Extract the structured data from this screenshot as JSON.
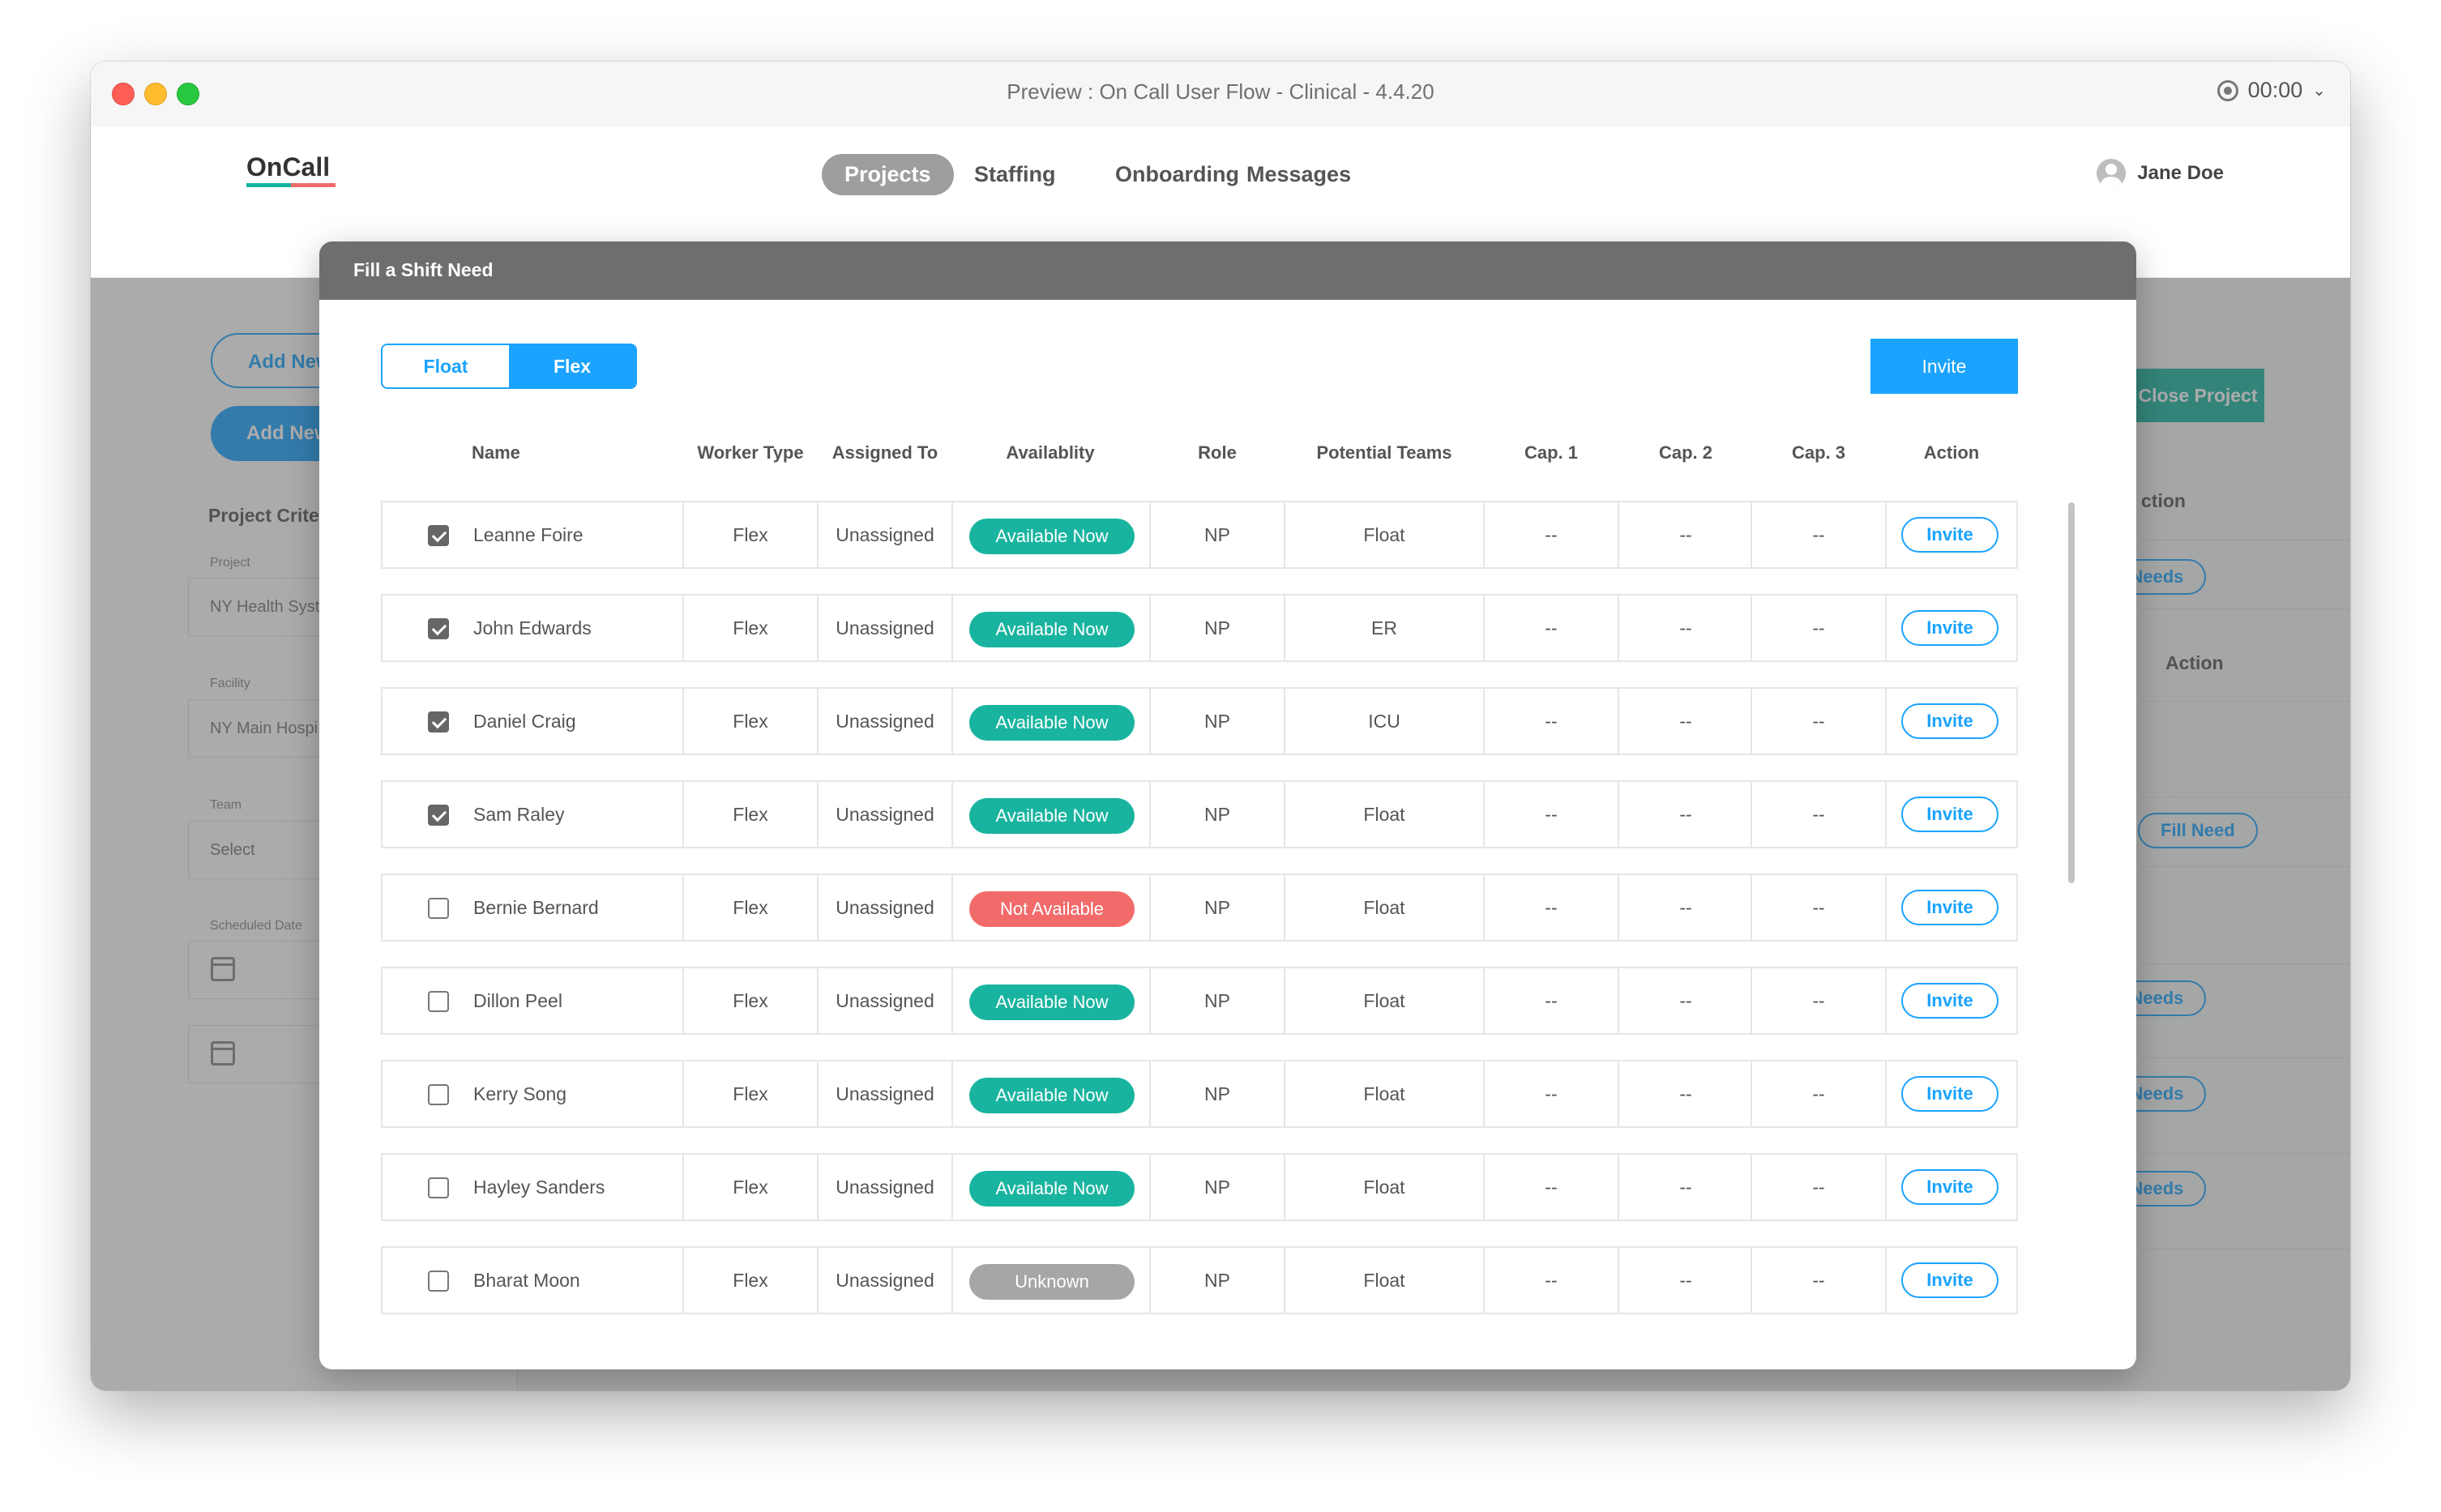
{
  "window": {
    "title": "Preview : On Call User Flow - Clinical - 4.4.20",
    "timer": "00:00"
  },
  "app": {
    "logo": "OnCall",
    "nav": [
      {
        "label": "Projects",
        "active": true
      },
      {
        "label": "Staffing",
        "active": false
      },
      {
        "label": "Onboarding",
        "active": false
      },
      {
        "label": "Messages",
        "active": false
      }
    ],
    "user": "Jane Doe"
  },
  "background": {
    "add_new_outline": "Add New",
    "add_new_filled": "Add New",
    "criteria_title": "Project Criter",
    "fields": [
      {
        "label": "Project",
        "value": "NY Health Syst"
      },
      {
        "label": "Facility",
        "value": "NY Main Hospi"
      },
      {
        "label": "Team",
        "value": "Select"
      }
    ],
    "scheduled_date_label": "Scheduled Date",
    "close_project": "Close Project",
    "action_top": "ction",
    "needs_top": "v Needs",
    "action_header": "Action",
    "fill_need": "Fill Need",
    "needs_rows": [
      "v Needs",
      "v Needs",
      "v Needs"
    ]
  },
  "modal": {
    "title": "Fill a Shift Need",
    "toggle": {
      "float": "Float",
      "flex": "Flex",
      "selected": "Flex"
    },
    "invite_button": "Invite",
    "columns": [
      "Name",
      "Worker Type",
      "Assigned To",
      "Availablity",
      "Role",
      "Potential Teams",
      "Cap. 1",
      "Cap. 2",
      "Cap. 3",
      "Action"
    ],
    "rows": [
      {
        "checked": true,
        "name": "Leanne Foire",
        "worker_type": "Flex",
        "assigned_to": "Unassigned",
        "availability": "Available Now",
        "role": "NP",
        "team": "Float",
        "cap1": "--",
        "cap2": "--",
        "cap3": "--",
        "action": "Invite"
      },
      {
        "checked": true,
        "name": "John Edwards",
        "worker_type": "Flex",
        "assigned_to": "Unassigned",
        "availability": "Available Now",
        "role": "NP",
        "team": "ER",
        "cap1": "--",
        "cap2": "--",
        "cap3": "--",
        "action": "Invite"
      },
      {
        "checked": true,
        "name": "Daniel Craig",
        "worker_type": "Flex",
        "assigned_to": "Unassigned",
        "availability": "Available Now",
        "role": "NP",
        "team": "ICU",
        "cap1": "--",
        "cap2": "--",
        "cap3": "--",
        "action": "Invite"
      },
      {
        "checked": true,
        "name": "Sam Raley",
        "worker_type": "Flex",
        "assigned_to": "Unassigned",
        "availability": "Available Now",
        "role": "NP",
        "team": "Float",
        "cap1": "--",
        "cap2": "--",
        "cap3": "--",
        "action": "Invite"
      },
      {
        "checked": false,
        "name": "Bernie Bernard",
        "worker_type": "Flex",
        "assigned_to": "Unassigned",
        "availability": "Not Available",
        "role": "NP",
        "team": "Float",
        "cap1": "--",
        "cap2": "--",
        "cap3": "--",
        "action": "Invite"
      },
      {
        "checked": false,
        "name": "Dillon Peel",
        "worker_type": "Flex",
        "assigned_to": "Unassigned",
        "availability": "Available Now",
        "role": "NP",
        "team": "Float",
        "cap1": "--",
        "cap2": "--",
        "cap3": "--",
        "action": "Invite"
      },
      {
        "checked": false,
        "name": "Kerry Song",
        "worker_type": "Flex",
        "assigned_to": "Unassigned",
        "availability": "Available Now",
        "role": "NP",
        "team": "Float",
        "cap1": "--",
        "cap2": "--",
        "cap3": "--",
        "action": "Invite"
      },
      {
        "checked": false,
        "name": "Hayley Sanders",
        "worker_type": "Flex",
        "assigned_to": "Unassigned",
        "availability": "Available Now",
        "role": "NP",
        "team": "Float",
        "cap1": "--",
        "cap2": "--",
        "cap3": "--",
        "action": "Invite"
      },
      {
        "checked": false,
        "name": "Bharat Moon",
        "worker_type": "Flex",
        "assigned_to": "Unassigned",
        "availability": "Unknown",
        "role": "NP",
        "team": "Float",
        "cap1": "--",
        "cap2": "--",
        "cap3": "--",
        "action": "Invite"
      }
    ]
  },
  "colors": {
    "accent_blue": "#1aa3ff",
    "teal": "#19b49f",
    "available": "#19b49f",
    "not_available": "#f26b6b",
    "unknown": "#a6a6a6",
    "logo_underline_left": "#19b49f",
    "logo_underline_right": "#f26b6b"
  }
}
